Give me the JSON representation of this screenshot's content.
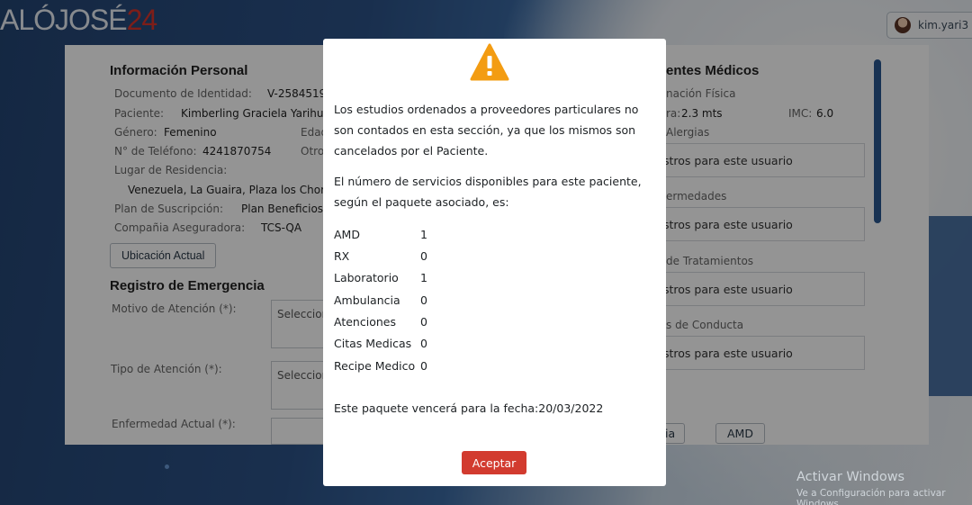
{
  "brand": {
    "logo_prefix": "ALÓJOSÉ",
    "logo_suffix": "24"
  },
  "user": {
    "name": "kim.yari3"
  },
  "left": {
    "personal_title": "Información Personal",
    "doc_label": "Documento de Identidad:",
    "doc_value": "V-2584519",
    "patient_label": "Paciente:",
    "patient_value": "Kimberling Graciela Yarihu",
    "gender_label": "Género:",
    "gender_value": "Femenino",
    "age_label": "Edad",
    "phone_label": "N° de Teléfono:",
    "phone_value": "4241870754",
    "other_label": "Otro",
    "residence_label": "Lugar de Residencia:",
    "residence_value": "Venezuela, La Guaira, Plaza los Chorr",
    "plan_label": "Plan de Suscripción:",
    "plan_value": "Plan Beneficios",
    "insurer_label": "Compañia Aseguradora:",
    "insurer_value": "TCS-QA",
    "location_button": "Ubicación Actual",
    "emergency_title": "Registro de Emergencia",
    "reason_label": "Motivo de Atención (*):",
    "reason_select": "Seleccion",
    "type_label": "Tipo de Atención (*):",
    "type_select": "Seleccion",
    "illness_label": "Enfermedad Actual (*):"
  },
  "right": {
    "title": "entes Médicos",
    "exam_label": "nación Física",
    "height_label": "ra:",
    "height_value": "2.3 mts",
    "imc_label": "IMC:",
    "imc_value": "6.0",
    "allergies_label": "Alergias",
    "allergies_value": "stros para este usuario",
    "diseases_label": "ermedades",
    "diseases_value": "stros para este usuario",
    "treatments_label": "de Tratamientos",
    "treatments_value": "stros para este usuario",
    "conduct_label": "s de Conducta",
    "conduct_value": "stros para este usuario",
    "tab_a": "ia",
    "tab_b": "AMD"
  },
  "modal": {
    "para1": "Los estudios ordenados a proveedores particulares no son contados en esta sección, ya que los mismos son cancelados por el Paciente.",
    "para2": "El número de servicios disponibles para este paciente, según el paquete asociado, es:",
    "services": [
      {
        "name": "AMD",
        "count": "1"
      },
      {
        "name": "RX",
        "count": "0"
      },
      {
        "name": "Laboratorio",
        "count": "1"
      },
      {
        "name": "Ambulancia",
        "count": "0"
      },
      {
        "name": "Atenciones",
        "count": "0"
      },
      {
        "name": "Citas Medicas",
        "count": "0"
      },
      {
        "name": "Recipe Medico",
        "count": "0"
      }
    ],
    "expiry": "Este paquete vencerá para la fecha:20/03/2022",
    "accept_button": "Aceptar"
  },
  "windows": {
    "line1": "Activar Windows",
    "line2": "Ve a Configuración para activar Windows."
  },
  "colors": {
    "accent_red": "#d23b2f",
    "warning_orange": "#f39c12",
    "navy": "#2a5790"
  }
}
